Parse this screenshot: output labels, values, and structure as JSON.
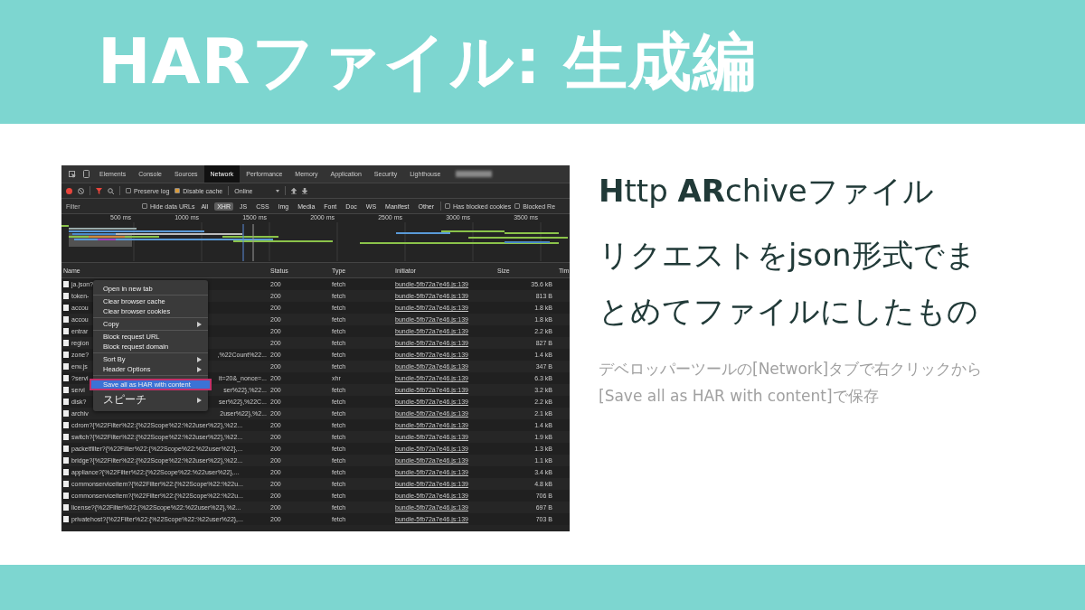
{
  "title": "HARファイル: 生成編",
  "devtools": {
    "tabs": [
      {
        "label": "Elements",
        "selected": false
      },
      {
        "label": "Console",
        "selected": false
      },
      {
        "label": "Sources",
        "selected": false
      },
      {
        "label": "Network",
        "selected": true
      },
      {
        "label": "Performance",
        "selected": false
      },
      {
        "label": "Memory",
        "selected": false
      },
      {
        "label": "Application",
        "selected": false
      },
      {
        "label": "Security",
        "selected": false
      },
      {
        "label": "Lighthouse",
        "selected": false
      }
    ],
    "toolbar": {
      "recording": true,
      "preserve_log": {
        "label": "Preserve log",
        "checked": false
      },
      "disable_cache": {
        "label": "Disable cache",
        "checked": true
      },
      "throttling": "Online"
    },
    "filter": {
      "placeholder": "Filter",
      "hide_data_urls": {
        "label": "Hide data URLs",
        "checked": false
      },
      "types": [
        {
          "label": "All",
          "selected": false
        },
        {
          "label": "XHR",
          "selected": true
        },
        {
          "label": "JS",
          "selected": false
        },
        {
          "label": "CSS",
          "selected": false
        },
        {
          "label": "Img",
          "selected": false
        },
        {
          "label": "Media",
          "selected": false
        },
        {
          "label": "Font",
          "selected": false
        },
        {
          "label": "Doc",
          "selected": false
        },
        {
          "label": "WS",
          "selected": false
        },
        {
          "label": "Manifest",
          "selected": false
        },
        {
          "label": "Other",
          "selected": false
        }
      ],
      "has_blocked_cookies": {
        "label": "Has blocked cookies",
        "checked": false
      },
      "blocked_requests": {
        "label": "Blocked Re",
        "checked": false
      }
    },
    "timeline_ticks": [
      "500 ms",
      "1000 ms",
      "1500 ms",
      "2000 ms",
      "2500 ms",
      "3000 ms",
      "3500 ms"
    ],
    "table": {
      "columns": [
        "Name",
        "Status",
        "Type",
        "Initiator",
        "Size",
        "Tim"
      ],
      "rows": [
        {
          "name": "ja.json?",
          "status": "200",
          "type": "fetch",
          "initiator": "bundle-5fb72a7e46.js:139",
          "size": "35.6 kB"
        },
        {
          "name": "token-",
          "status": "200",
          "type": "fetch",
          "initiator": "bundle-5fb72a7e46.js:139",
          "size": "813 B"
        },
        {
          "name": "accou",
          "status": "200",
          "type": "fetch",
          "initiator": "bundle-5fb72a7e46.js:139",
          "size": "1.8 kB"
        },
        {
          "name": "accou",
          "status": "200",
          "type": "fetch",
          "initiator": "bundle-5fb72a7e46.js:139",
          "size": "1.8 kB"
        },
        {
          "name": "entrar",
          "status": "200",
          "type": "fetch",
          "initiator": "bundle-5fb72a7e46.js:139",
          "size": "2.2 kB"
        },
        {
          "name": "region",
          "status": "200",
          "type": "fetch",
          "initiator": "bundle-5fb72a7e46.js:139",
          "size": "827 B"
        },
        {
          "name": "zone?",
          "name_tail": ",%22Count%22...",
          "status": "200",
          "type": "fetch",
          "initiator": "bundle-5fb72a7e46.js:139",
          "size": "1.4 kB"
        },
        {
          "name": "env.js",
          "status": "200",
          "type": "fetch",
          "initiator": "bundle-5fb72a7e46.js:139",
          "size": "347 B"
        },
        {
          "name": "?servi",
          "name_tail": "it=20&_nonce=...",
          "status": "200",
          "type": "xhr",
          "initiator": "bundle-5fb72a7e46.js:139",
          "size": "6.3 kB"
        },
        {
          "name": "servi",
          "name_tail": "ser%22},%22...",
          "status": "200",
          "type": "fetch",
          "initiator": "bundle-5fb72a7e46.js:139",
          "size": "3.2 kB"
        },
        {
          "name": "disk?",
          "name_tail": "ser%22},%22C...",
          "status": "200",
          "type": "fetch",
          "initiator": "bundle-5fb72a7e46.js:139",
          "size": "2.2 kB"
        },
        {
          "name": "archiv",
          "name_tail": "2user%22},%2...",
          "status": "200",
          "type": "fetch",
          "initiator": "bundle-5fb72a7e46.js:139",
          "size": "2.1 kB"
        },
        {
          "name": "cdrom?{%22Filter%22:{%22Scope%22:%22user%22},%22...",
          "status": "200",
          "type": "fetch",
          "initiator": "bundle-5fb72a7e46.js:139",
          "size": "1.4 kB"
        },
        {
          "name": "switch?{%22Filter%22:{%22Scope%22:%22user%22},%22...",
          "status": "200",
          "type": "fetch",
          "initiator": "bundle-5fb72a7e46.js:139",
          "size": "1.9 kB"
        },
        {
          "name": "packetfilter?{%22Filter%22:{%22Scope%22:%22user%22},...",
          "status": "200",
          "type": "fetch",
          "initiator": "bundle-5fb72a7e46.js:139",
          "size": "1.3 kB"
        },
        {
          "name": "bridge?{%22Filter%22:{%22Scope%22:%22user%22},%22...",
          "status": "200",
          "type": "fetch",
          "initiator": "bundle-5fb72a7e46.js:139",
          "size": "1.1 kB"
        },
        {
          "name": "appliance?{%22Filter%22:{%22Scope%22:%22user%22},...",
          "status": "200",
          "type": "fetch",
          "initiator": "bundle-5fb72a7e46.js:139",
          "size": "3.4 kB"
        },
        {
          "name": "commonserviceitem?{%22Filter%22:{%22Scope%22:%22u...",
          "status": "200",
          "type": "fetch",
          "initiator": "bundle-5fb72a7e46.js:139",
          "size": "4.8 kB"
        },
        {
          "name": "commonserviceitem?{%22Filter%22:{%22Scope%22:%22u...",
          "status": "200",
          "type": "fetch",
          "initiator": "bundle-5fb72a7e46.js:139",
          "size": "706 B"
        },
        {
          "name": "license?{%22Filter%22:{%22Scope%22:%22user%22},%2...",
          "status": "200",
          "type": "fetch",
          "initiator": "bundle-5fb72a7e46.js:139",
          "size": "697 B"
        },
        {
          "name": "privatehost?{%22Filter%22:{%22Scope%22:%22user%22},...",
          "status": "200",
          "type": "fetch",
          "initiator": "bundle-5fb72a7e46.js:139",
          "size": "703 B"
        }
      ]
    },
    "context_menu": {
      "groups": [
        [
          {
            "label": "Open in new tab",
            "submenu": false,
            "selected": false
          }
        ],
        [
          {
            "label": "Clear browser cache",
            "submenu": false,
            "selected": false
          },
          {
            "label": "Clear browser cookies",
            "submenu": false,
            "selected": false
          }
        ],
        [
          {
            "label": "Copy",
            "submenu": true,
            "selected": false
          }
        ],
        [
          {
            "label": "Block request URL",
            "submenu": false,
            "selected": false
          },
          {
            "label": "Block request domain",
            "submenu": false,
            "selected": false
          }
        ],
        [
          {
            "label": "Sort By",
            "submenu": true,
            "selected": false
          },
          {
            "label": "Header Options",
            "submenu": true,
            "selected": false
          }
        ],
        [
          {
            "label": "Save all as HAR with content",
            "submenu": false,
            "selected": true
          },
          {
            "label": "スピーチ",
            "submenu": true,
            "selected": false
          }
        ]
      ]
    }
  },
  "heading": "**H**ttp **AR**chiveファイル",
  "description": "リクエストをjson形式でまとめてファイルにしたもの",
  "note": "デベロッパーツールの[Network]タブで右クリックから[Save all as HAR with content]で保存"
}
